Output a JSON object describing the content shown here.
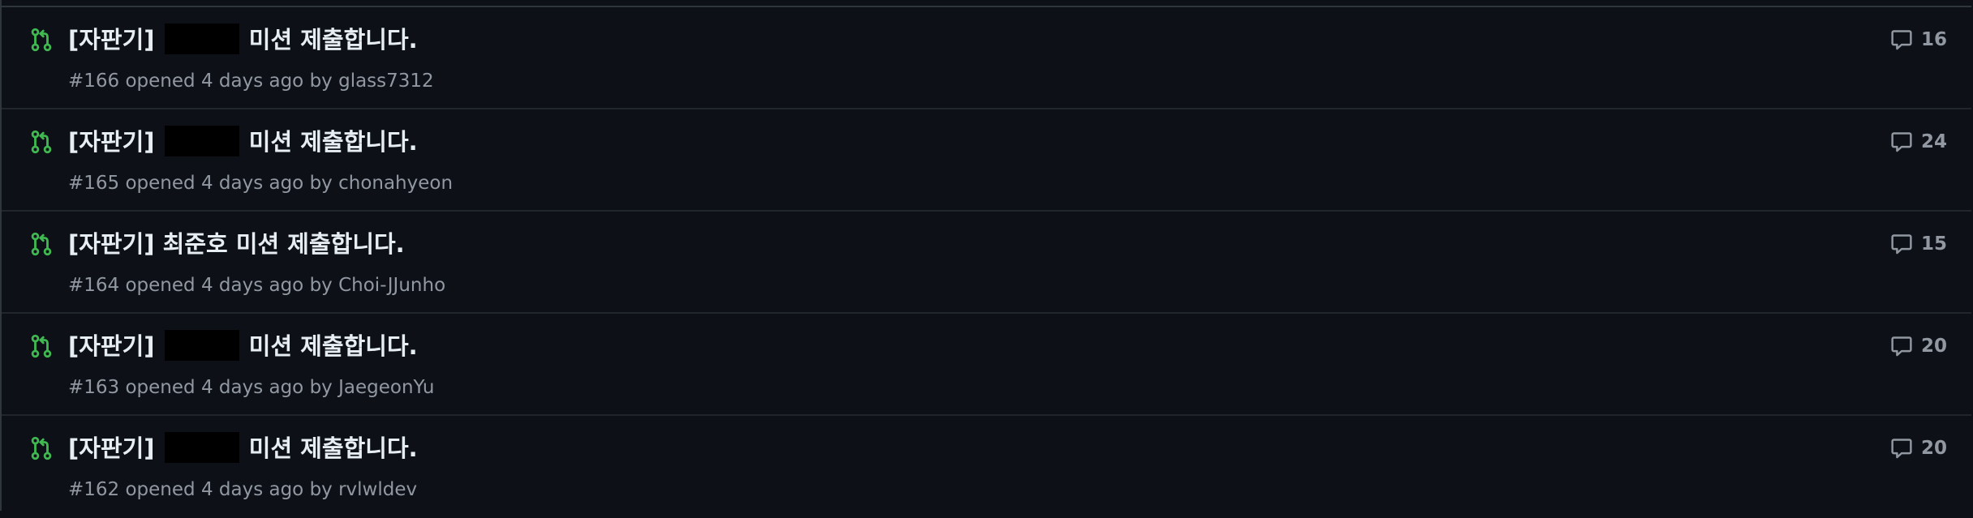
{
  "colors": {
    "background": "#0d1117",
    "open_pr_icon": "#3fb950",
    "title_text": "#e6edf3",
    "meta_text": "#9198a1",
    "divider": "#21262d"
  },
  "icons": {
    "pr_status": "git-pull-request-open-icon",
    "comments": "comment-icon"
  },
  "pull_requests": [
    {
      "title_prefix": "[자판기]",
      "title_name": "",
      "name_redacted": true,
      "title_suffix": "미션 제출합니다.",
      "number": "#166",
      "opened_text": "opened 4 days ago by",
      "author": "glass7312",
      "comments": "16"
    },
    {
      "title_prefix": "[자판기]",
      "title_name": "",
      "name_redacted": true,
      "title_suffix": "미션 제출합니다.",
      "number": "#165",
      "opened_text": "opened 4 days ago by",
      "author": "chonahyeon",
      "comments": "24"
    },
    {
      "title_prefix": "[자판기]",
      "title_name": "최준호",
      "name_redacted": false,
      "title_suffix": "미션 제출합니다.",
      "number": "#164",
      "opened_text": "opened 4 days ago by",
      "author": "Choi-JJunho",
      "comments": "15"
    },
    {
      "title_prefix": "[자판기]",
      "title_name": "",
      "name_redacted": true,
      "title_suffix": "미션 제출합니다.",
      "number": "#163",
      "opened_text": "opened 4 days ago by",
      "author": "JaegeonYu",
      "comments": "20"
    },
    {
      "title_prefix": "[자판기]",
      "title_name": "",
      "name_redacted": true,
      "title_suffix": "미션 제출합니다.",
      "number": "#162",
      "opened_text": "opened 4 days ago by",
      "author": "rvlwldev",
      "comments": "20"
    }
  ]
}
